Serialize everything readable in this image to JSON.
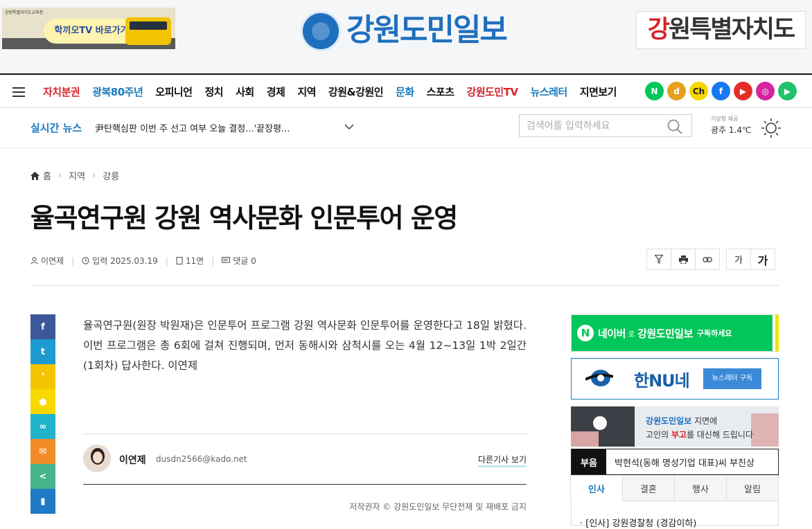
{
  "header": {
    "ad_left": {
      "org": "강원특별자치도교육청",
      "text": "학끼오TV 바로가기"
    },
    "logo_text": "강원도민일보",
    "region_banner": "강원특별자치도"
  },
  "nav": {
    "items": [
      {
        "label": "자치분권",
        "color": "#d8232a"
      },
      {
        "label": "광복80주년",
        "color": "#1a7bbf"
      },
      {
        "label": "오피니언",
        "color": "#111111"
      },
      {
        "label": "정치",
        "color": "#111111"
      },
      {
        "label": "사회",
        "color": "#111111"
      },
      {
        "label": "경제",
        "color": "#111111"
      },
      {
        "label": "지역",
        "color": "#111111"
      },
      {
        "label": "강원&강원인",
        "color": "#111111"
      },
      {
        "label": "문화",
        "color": "#1a7bbf"
      },
      {
        "label": "스포츠",
        "color": "#111111"
      },
      {
        "label": "강원도민TV",
        "color": "#d8232a"
      },
      {
        "label": "뉴스레터",
        "color": "#1a7bbf"
      },
      {
        "label": "지면보기",
        "color": "#111111"
      }
    ],
    "socials": [
      {
        "icon": "naver-icon",
        "glyph": "N",
        "color": "#03c75a"
      },
      {
        "icon": "daum-icon",
        "glyph": "d",
        "color": "#e6a020"
      },
      {
        "icon": "kakao-channel-icon",
        "glyph": "Ch",
        "color": "#f7d600"
      },
      {
        "icon": "facebook-icon",
        "glyph": "f",
        "color": "#1877f2"
      },
      {
        "icon": "youtube-icon",
        "glyph": "▶",
        "color": "#e52d27"
      },
      {
        "icon": "instagram-icon",
        "glyph": "◎",
        "color": "#d6249f"
      },
      {
        "icon": "play-icon",
        "glyph": "▶",
        "color": "#21c26b"
      }
    ]
  },
  "live": {
    "label": "실시간 뉴스",
    "headline": "尹탄핵심판 이번 주 선고 여부 오늘 결정...'끝장평..."
  },
  "search": {
    "placeholder": "검색어를 입력하세요"
  },
  "weather": {
    "source": "기상청 제공",
    "location": "광주",
    "temp": "1.4℃"
  },
  "breadcrumb": {
    "home": "홈",
    "level1": "지역",
    "level2": "강릉"
  },
  "article": {
    "title": "율곡연구원 강원 역사문화 인문투어 운영",
    "author": "이연제",
    "date": "입력 2025.03.19",
    "page": "11면",
    "comments": "댓글 0",
    "font_small": "가",
    "font_large": "가",
    "body": "율곡연구원(원장 박원재)은 인문투어 프로그램 강원 역사문화 인문투어를 운영한다고 18일 밝혔다. 이번 프로그램은 총 6회에 걸쳐 진행되며, 먼저 동해시와 삼척시를 오는 4월 12~13일 1박 2일간(1회차) 답사한다. 이연제",
    "byline_name": "이연제",
    "byline_email": "dusdn2566@kado.net",
    "more_link": "다른기사 보기",
    "copyright": "저작권자 © 강원도민일보 무단전재 및 재배포 금지"
  },
  "share": [
    {
      "icon": "facebook-icon",
      "glyph": "f",
      "color": "#3b5998"
    },
    {
      "icon": "twitter-icon",
      "glyph": "t",
      "color": "#1d9bd1"
    },
    {
      "icon": "kakao-story-icon",
      "glyph": "❜",
      "color": "#f4c400"
    },
    {
      "icon": "kakaotalk-icon",
      "glyph": "●",
      "color": "#f9d800"
    },
    {
      "icon": "link-icon",
      "glyph": "∞",
      "color": "#20b3c9"
    },
    {
      "icon": "email-icon",
      "glyph": "✉",
      "color": "#f28c28"
    },
    {
      "icon": "share-icon",
      "glyph": "<",
      "color": "#45b58c"
    },
    {
      "icon": "bookmark-icon",
      "glyph": "▮",
      "color": "#1f7bc6"
    }
  ],
  "sidebar": {
    "naver_ad": {
      "badge": "N",
      "brand": "네이버",
      "particle": "로",
      "name": "강원도민일보",
      "cta": "구독하세요"
    },
    "hannu_ad": {
      "name": "한NU네",
      "cta": "뉴스레터 구독"
    },
    "obit_ad": {
      "line1_brand": "강원도민일보",
      "line1_rest": " 지면에",
      "line2_pre": "고인의 ",
      "line2_hl": "부고",
      "line2_post": "를 대신해 드립니다"
    },
    "obit": {
      "tag": "부음",
      "text": "박현석(동해 명성기업 대표)씨 부친상"
    },
    "tabs": [
      "인사",
      "결혼",
      "행사",
      "알림"
    ],
    "tab_item": "· [인사] 강원경찰청 (경감이하)"
  }
}
